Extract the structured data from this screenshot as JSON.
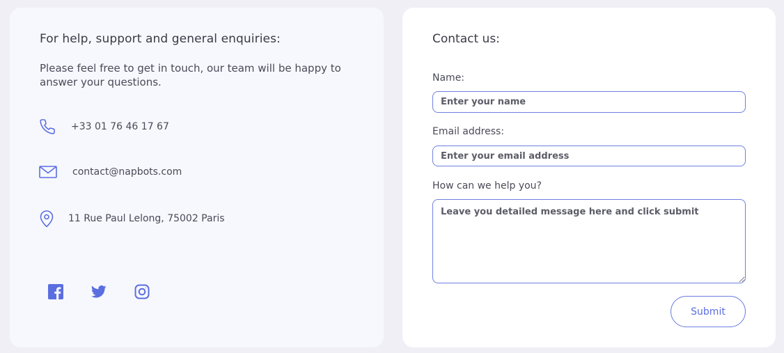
{
  "info": {
    "title": "For help, support and general enquiries:",
    "description": "Please feel free to get in touch, our team will be happy to answer your questions.",
    "phone": "+33 01 76 46 17 67",
    "email": "contact@napbots.com",
    "address": "11 Rue Paul Lelong, 75002 Paris",
    "icons": {
      "phone": "phone-icon",
      "email": "mail-icon",
      "address": "location-pin-icon"
    },
    "socials": [
      "facebook-icon",
      "twitter-icon",
      "instagram-icon"
    ]
  },
  "form": {
    "title": "Contact us:",
    "name_label": "Name:",
    "name_placeholder": "Enter your name",
    "email_label": "Email address:",
    "email_placeholder": "Enter your email address",
    "message_label": "How can we help you?",
    "message_placeholder": "Leave you detailed message here and click submit",
    "submit_label": "Submit"
  },
  "colors": {
    "accent": "#5b6ee0",
    "page_background": "#efeff5",
    "left_card": "#f7f8fd",
    "right_card": "#ffffff"
  }
}
